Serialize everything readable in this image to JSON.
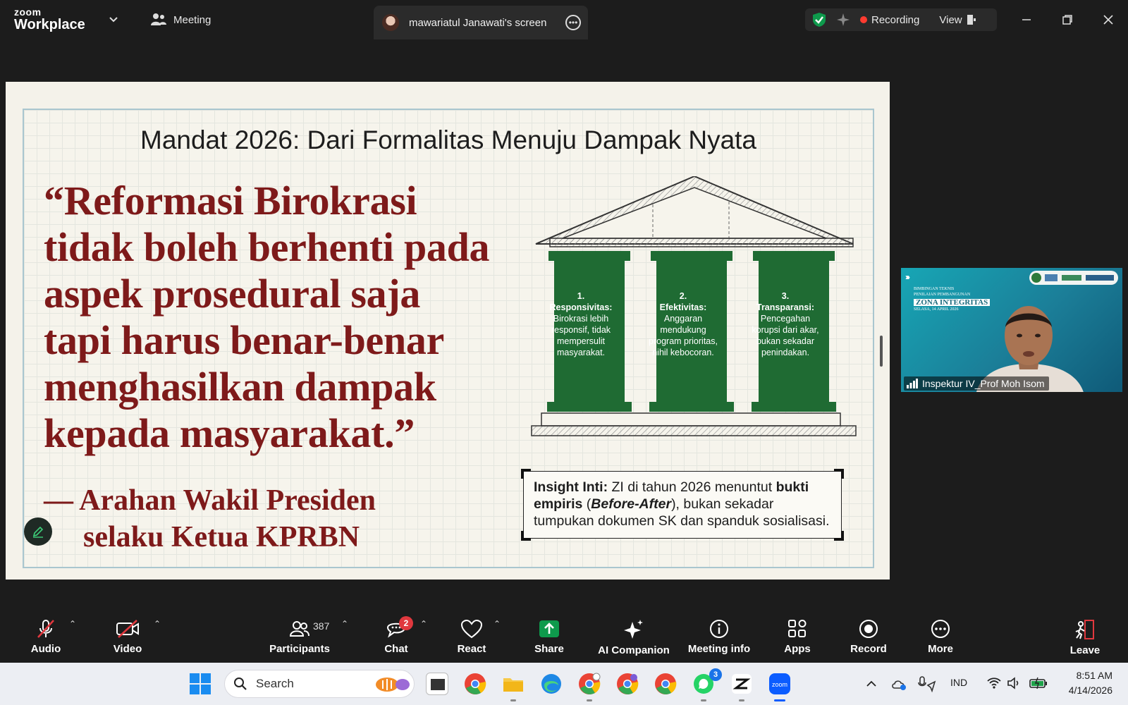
{
  "app": {
    "brand_small": "zoom",
    "brand_large": "Workplace",
    "meeting_label": "Meeting"
  },
  "share_tab": {
    "label": "mawariatul Janawati's screen"
  },
  "recording": {
    "label": "Recording",
    "view_label": "View"
  },
  "slide": {
    "title": "Mandat 2026: Dari Formalitas Menuju Dampak Nyata",
    "quote_lines": [
      "“Reformasi Birokrasi",
      "tidak boleh berhenti pada",
      "aspek prosedural saja",
      "tapi harus benar-benar",
      "menghasilkan dampak",
      "kepada masyarakat.”"
    ],
    "attribution_line1": "— Arahan Wakil Presiden",
    "attribution_line2": "selaku Ketua KPRBN",
    "pillars": [
      {
        "num": "1.",
        "title": "Responsivitas:",
        "body": "Birokrasi lebih responsif, tidak mempersulit masyarakat."
      },
      {
        "num": "2.",
        "title": "Efektivitas:",
        "body": "Anggaran mendukung program prioritas, nihil kebocoran."
      },
      {
        "num": "3.",
        "title": "Transparansi:",
        "body": "Pencegahan korupsi dari akar, bukan sekadar penindakan."
      }
    ],
    "insight": {
      "label": "Insight Inti:",
      "text_a": " ZI di tahun 2026 menuntut ",
      "bold_a": "bukti empiris",
      "text_b": " (",
      "italic_b": "Before-After",
      "text_c": "), bukan sekadar tumpukan dokumen SK dan spanduk sosialisasi."
    }
  },
  "video_tile": {
    "participant_name": "Inspektur IV_Prof Moh Isom",
    "banner_line1": "BIMBINGAN TEKNIS",
    "banner_line2": "PENILAIAN PEMBANGUNAN",
    "banner_title": "ZONA INTEGRITAS",
    "banner_date": "SELASA, 14 APRIL 2026"
  },
  "toolbar": {
    "audio": "Audio",
    "video": "Video",
    "participants": "Participants",
    "participants_count": "387",
    "chat": "Chat",
    "chat_badge": "2",
    "react": "React",
    "share": "Share",
    "ai_companion": "AI Companion",
    "meeting_info": "Meeting info",
    "apps": "Apps",
    "record": "Record",
    "more": "More",
    "leave": "Leave"
  },
  "taskbar": {
    "search_placeholder": "Search",
    "whatsapp_badge": "3",
    "language": "IND",
    "time": "8:51 AM",
    "date": "4/14/2026"
  },
  "colors": {
    "accent_green": "#0e9a4c",
    "quote_red": "#7e1a1a",
    "pillar_green": "#1f6b33",
    "recording_red": "#ff3b30"
  }
}
